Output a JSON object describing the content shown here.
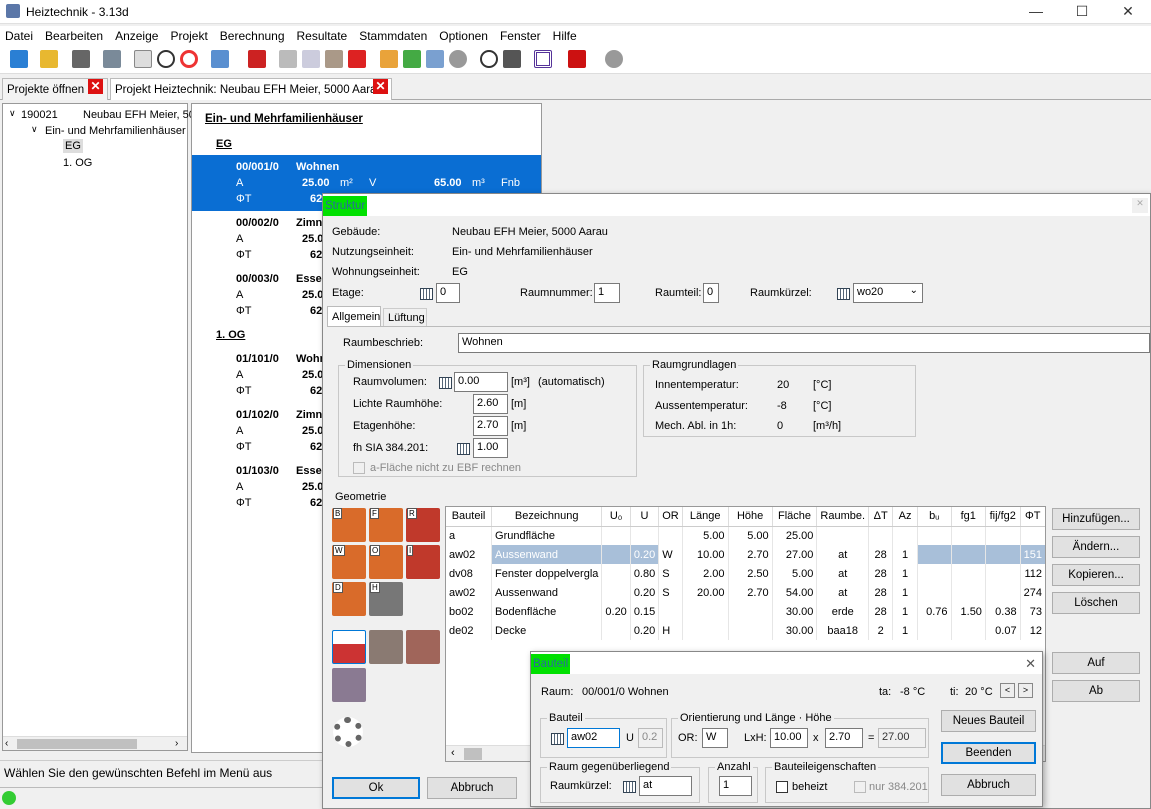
{
  "app": {
    "title": "Heiztechnik - 3.13d"
  },
  "menu": [
    "Datei",
    "Bearbeiten",
    "Anzeige",
    "Projekt",
    "Berechnung",
    "Resultate",
    "Stammdaten",
    "Optionen",
    "Fenster",
    "Hilfe"
  ],
  "tabs": [
    "Projekte öffnen",
    "Projekt Heiztechnik: Neubau EFH Meier, 5000 Aarau"
  ],
  "tree": {
    "root_id": "190021",
    "root_name": "Neubau EFH Meier, 50",
    "unit": "Ein- und Mehrfamilienhäuser",
    "levels": [
      "EG",
      "1. OG"
    ]
  },
  "list": {
    "heading": "Ein- und Mehrfamilienhäuser",
    "eg": "EG",
    "og": "1. OG",
    "a": "A",
    "phi": "ΦT",
    "m2": "m²",
    "v": "V",
    "m3": "m³",
    "rooms": [
      {
        "code": "00/001/0",
        "name": "Wohnen",
        "area": "25.00",
        "vol": "65.00",
        "fnb": "Fnb",
        "phi": "62"
      },
      {
        "code": "00/002/0",
        "name": "Zimn",
        "area": "25.0",
        "phi": "62"
      },
      {
        "code": "00/003/0",
        "name": "Esse",
        "area": "25.0",
        "phi": "62"
      },
      {
        "code": "01/101/0",
        "name": "Wohr",
        "area": "25.0",
        "phi": "62"
      },
      {
        "code": "01/102/0",
        "name": "Zimn",
        "area": "25.0",
        "phi": "62"
      },
      {
        "code": "01/103/0",
        "name": "Esse",
        "area": "25.0",
        "phi": "62"
      }
    ]
  },
  "status": {
    "text": "Wählen Sie den gewünschten Befehl im Menü aus"
  },
  "struktur": {
    "title": "Struktur",
    "gebaeude_lbl": "Gebäude:",
    "gebaeude": "Neubau EFH Meier, 5000 Aarau",
    "nutzung_lbl": "Nutzungseinheit:",
    "nutzung": "Ein- und Mehrfamilienhäuser",
    "wohnung_lbl": "Wohnungseinheit:",
    "wohnung": "EG",
    "etage_lbl": "Etage:",
    "etage": "0",
    "raumnummer_lbl": "Raumnummer:",
    "raumnummer": "1",
    "raumteil_lbl": "Raumteil:",
    "raumteil": "0",
    "raumkuerzel_lbl": "Raumkürzel:",
    "raumkuerzel": "wo20",
    "tabs": [
      "Allgemein",
      "Lüftung"
    ],
    "raumbeschrieb_lbl": "Raumbeschrieb:",
    "raumbeschrieb": "Wohnen",
    "dim": {
      "title": "Dimensionen",
      "volumen_lbl": "Raumvolumen:",
      "volumen": "0.00",
      "volumen_unit": "[m³]",
      "volumen_note": "(automatisch)",
      "lichte_lbl": "Lichte Raumhöhe:",
      "lichte": "2.60",
      "lichte_unit": "[m]",
      "etagen_lbl": "Etagenhöhe:",
      "etagen": "2.70",
      "etagen_unit": "[m]",
      "fh_lbl": "fh SIA 384.201:",
      "fh": "1.00",
      "afl": "a-Fläche nicht zu EBF rechnen"
    },
    "grund": {
      "title": "Raumgrundlagen",
      "innen_lbl": "Innentemperatur:",
      "innen": "20",
      "innen_unit": "[°C]",
      "aussen_lbl": "Aussentemperatur:",
      "aussen": "-8",
      "aussen_unit": "[°C]",
      "mech_lbl": "Mech. Abl. in 1h:",
      "mech": "0",
      "mech_unit": "[m³/h]"
    },
    "geometrie": "Geometrie",
    "icon_letters": [
      "B",
      "F",
      "R",
      "W",
      "O",
      "I",
      "D",
      "H"
    ],
    "table": {
      "headers": [
        "Bauteil",
        "Bezeichnung",
        "U₀",
        "U",
        "OR",
        "Länge",
        "Höhe",
        "Fläche",
        "Raumbe.",
        "ΔT",
        "Az",
        "bᵤ",
        "fg1",
        "fij/fg2",
        "ΦT"
      ],
      "rows": [
        [
          "a",
          "Grundfläche",
          "",
          "",
          "",
          "5.00",
          "5.00",
          "25.00",
          "",
          "",
          "",
          "",
          "",
          "",
          ""
        ],
        [
          "aw02",
          "Aussenwand",
          "",
          "0.20",
          "W",
          "10.00",
          "2.70",
          "27.00",
          "at",
          "28",
          "1",
          "",
          "",
          "",
          "151"
        ],
        [
          "dv08",
          "Fenster doppelvergla",
          "",
          "0.80",
          "S",
          "2.00",
          "2.50",
          "5.00",
          "at",
          "28",
          "1",
          "",
          "",
          "",
          "112"
        ],
        [
          "aw02",
          "Aussenwand",
          "",
          "0.20",
          "S",
          "20.00",
          "2.70",
          "54.00",
          "at",
          "28",
          "1",
          "",
          "",
          "",
          "274"
        ],
        [
          "bo02",
          "Bodenfläche",
          "0.20",
          "0.15",
          "",
          "",
          "",
          "30.00",
          "erde",
          "28",
          "1",
          "0.76",
          "1.50",
          "0.38",
          "73"
        ],
        [
          "de02",
          "Decke",
          "",
          "0.20",
          "H",
          "",
          "",
          "30.00",
          "baa18",
          "2",
          "1",
          "",
          "",
          "0.07",
          "12"
        ]
      ]
    },
    "buttons": {
      "add": "Hinzufügen...",
      "edit": "Ändern...",
      "copy": "Kopieren...",
      "delete": "Löschen",
      "up": "Auf",
      "down": "Ab",
      "ok": "Ok",
      "cancel": "Abbruch"
    }
  },
  "bauteil": {
    "title": "Bauteil",
    "raum_lbl": "Raum:",
    "raum": "00/001/0  Wohnen",
    "ta_lbl": "ta:",
    "ta": "-8  °C",
    "ti_lbl": "ti:",
    "ti": "20 °C",
    "bauteil_grp": "Bauteil",
    "bauteil": "aw02",
    "u_lbl": "U",
    "u": "0.2",
    "orient_grp": "Orientierung und Länge · Höhe",
    "or_lbl": "OR:",
    "or": "W",
    "lxh_lbl": "LxH:",
    "l": "10.00",
    "x": "x",
    "h": "2.70",
    "eq": "=",
    "area": "27.00",
    "raum_grp": "Raum gegenüberliegend",
    "rk_lbl": "Raumkürzel:",
    "rk": "at",
    "anzahl_grp": "Anzahl",
    "anzahl": "1",
    "eigen_grp": "Bauteileigenschaften",
    "beheizt": "beheizt",
    "nur": "nur 384.201",
    "btn_neu": "Neues Bauteil",
    "btn_beenden": "Beenden",
    "btn_abbruch": "Abbruch"
  },
  "colors": {
    "selection": "#0a6ed3",
    "caption_green": "#00e000",
    "close_red": "#d11111",
    "highlight": "#a8bfd9"
  }
}
